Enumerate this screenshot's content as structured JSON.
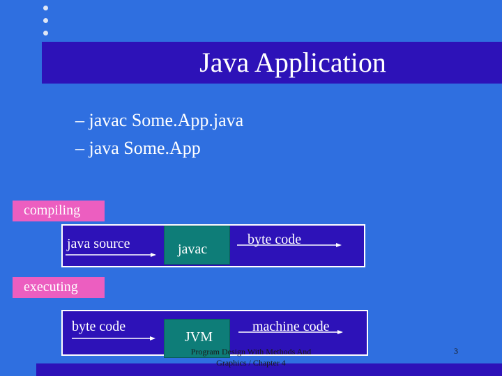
{
  "slide": {
    "title": "Java Application",
    "bullets": [
      "– javac Some.App.java",
      "– java Some.App"
    ]
  },
  "compiling": {
    "label": "compiling",
    "source": "java source",
    "tool": "javac",
    "output": "byte code"
  },
  "executing": {
    "label": "executing",
    "source": "byte code",
    "tool": "JVM",
    "output": "machine code"
  },
  "footer": {
    "line1": "Program Design With Methods And",
    "line2": "Graphics / Chapter 4",
    "page": "3"
  },
  "colors": {
    "background": "#2f6fe0",
    "title_bar": "#2d12b8",
    "label_box": "#ec5ec0",
    "tool_box": "#0e7d78"
  }
}
